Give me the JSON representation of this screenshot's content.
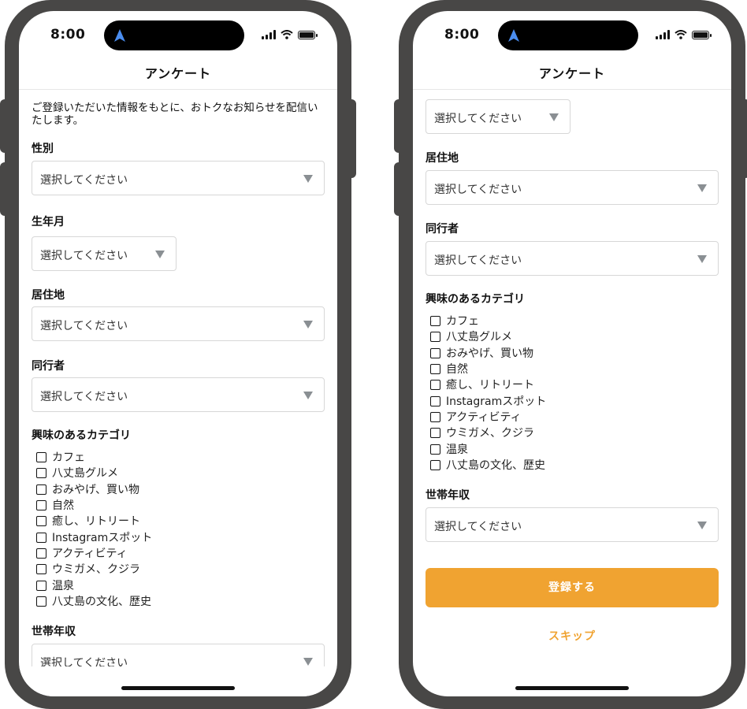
{
  "status_bar": {
    "time": "8:00"
  },
  "nav": {
    "title": "アンケート"
  },
  "intro": "ご登録いただいた情報をもとに、おトクなお知らせを配信いたします。",
  "fields": {
    "gender": {
      "label": "性別",
      "placeholder": "選択してください"
    },
    "birth_month": {
      "label": "生年月",
      "placeholder": "選択してください"
    },
    "residence": {
      "label": "居住地",
      "placeholder": "選択してください"
    },
    "companion": {
      "label": "同行者",
      "placeholder": "選択してください"
    },
    "interests": {
      "label": "興味のあるカテゴリ",
      "options": [
        "カフェ",
        "八丈島グルメ",
        "おみやげ、買い物",
        "自然",
        "癒し、リトリート",
        "Instagramスポット",
        "アクティビティ",
        "ウミガメ、クジラ",
        "温泉",
        "八丈島の文化、歴史"
      ]
    },
    "income": {
      "label": "世帯年収",
      "placeholder": "選択してください"
    }
  },
  "actions": {
    "register": "登録する",
    "skip": "スキップ"
  },
  "colors": {
    "accent": "#f0a331",
    "frame": "#484746",
    "arrow": "#8a8f93"
  },
  "icons": {
    "island": "location-arrow-icon",
    "signal": "cellular-signal-icon",
    "wifi": "wifi-icon",
    "battery": "battery-icon"
  }
}
